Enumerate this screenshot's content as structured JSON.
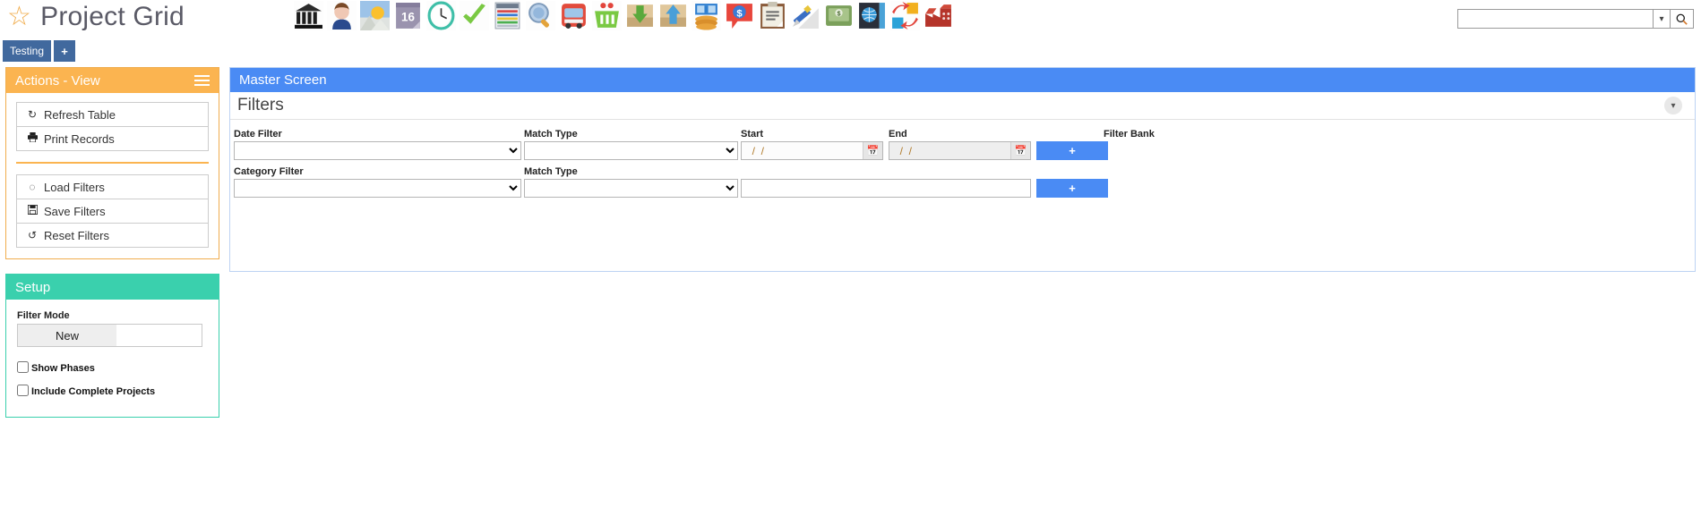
{
  "app": {
    "title": "Project Grid",
    "star_icon": "star-icon"
  },
  "search": {
    "value": "",
    "placeholder": "",
    "caret_icon": "chevron-down-icon",
    "go_icon": "search-icon"
  },
  "toolbar": {
    "icons": [
      {
        "name": "bank-icon"
      },
      {
        "name": "person-icon"
      },
      {
        "name": "photo-icon"
      },
      {
        "name": "calendar-16-icon"
      },
      {
        "name": "clock-icon"
      },
      {
        "name": "checkmark-icon"
      },
      {
        "name": "spreadsheet-icon"
      },
      {
        "name": "magnifier-globe-icon"
      },
      {
        "name": "bus-icon"
      },
      {
        "name": "shopping-basket-icon"
      },
      {
        "name": "inbox-download-icon"
      },
      {
        "name": "outbox-upload-icon"
      },
      {
        "name": "money-hands-icon"
      },
      {
        "name": "dollar-speech-icon"
      },
      {
        "name": "clipboard-icon"
      },
      {
        "name": "pencil-note-icon"
      },
      {
        "name": "cash-envelope-icon"
      },
      {
        "name": "globe-book-icon"
      },
      {
        "name": "swap-arrows-icon"
      },
      {
        "name": "factory-icon"
      }
    ]
  },
  "tabs": {
    "items": [
      {
        "label": "Testing",
        "name": "tab-testing"
      }
    ],
    "add_label": "+"
  },
  "actions_panel": {
    "title": "Actions - View",
    "menu_icon": "hamburger-icon",
    "group_one": [
      {
        "label": "Refresh Table",
        "icon": "refresh-icon",
        "glyph": "↻"
      },
      {
        "label": "Print Records",
        "icon": "printer-icon",
        "glyph": "⎙"
      }
    ],
    "group_two": [
      {
        "label": "Load Filters",
        "icon": "spinner-icon",
        "glyph": "◌"
      },
      {
        "label": "Save Filters",
        "icon": "floppy-disk-icon",
        "glyph": "Ὃe"
      },
      {
        "label": "Reset Filters",
        "icon": "undo-icon",
        "glyph": "↺"
      }
    ]
  },
  "setup_panel": {
    "title": "Setup",
    "filter_mode_label": "Filter Mode",
    "filter_mode_value": "New",
    "checkboxes": [
      {
        "label": "Show Phases",
        "checked": false
      },
      {
        "label": "Include Complete Projects",
        "checked": false
      }
    ]
  },
  "master": {
    "title": "Master Screen",
    "filters_title": "Filters",
    "collapse_icon": "chevron-down-icon",
    "rows": [
      {
        "label": "Date Filter",
        "value": "",
        "match_label": "Match Type",
        "match_value": "",
        "start_label": "Start",
        "start_value": "  /  /",
        "end_label": "End",
        "end_value": "  /  /",
        "bank_label": "Filter Bank",
        "add_label": "+"
      },
      {
        "label": "Category Filter",
        "value": "",
        "match_label": "Match Type",
        "match_value": "",
        "text_value": "",
        "add_label": "+"
      }
    ]
  },
  "colors": {
    "brand_blue": "#4a8bf4",
    "tab_blue": "#41699e",
    "orange": "#fbb450",
    "teal": "#3ad0ad",
    "star": "#f0ad4e"
  }
}
